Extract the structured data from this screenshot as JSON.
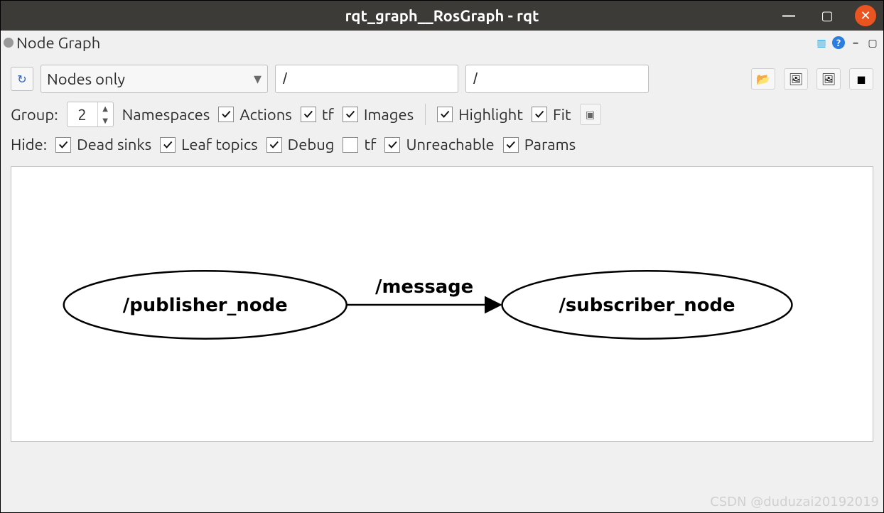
{
  "title": "rqt_graph__RosGraph - rqt",
  "tab": {
    "title": "Node Graph"
  },
  "filter_mode": "Nodes only",
  "filter1": "/",
  "filter2": "/",
  "group": {
    "label": "Group:",
    "value": "2"
  },
  "checks": {
    "namespaces": "Namespaces",
    "actions": "Actions",
    "tf1": "tf",
    "images": "Images",
    "highlight": "Highlight",
    "fit": "Fit"
  },
  "hide": {
    "label": "Hide:",
    "dead_sinks": "Dead sinks",
    "leaf_topics": "Leaf topics",
    "debug": "Debug",
    "tf2": "tf",
    "unreachable": "Unreachable",
    "params": "Params"
  },
  "toolbar_icons": {
    "refresh": "↻",
    "open": "📂",
    "save_img": "🖼",
    "save_dot": "🖼",
    "layout": "◼"
  },
  "titlebar_icons": {
    "minimize": "—",
    "maximize": "▢",
    "close": "✕"
  },
  "graph": {
    "node1": "/publisher_node",
    "node2": "/subscriber_node",
    "edge_label": "/message"
  },
  "watermark": "CSDN @duduzai20192019"
}
